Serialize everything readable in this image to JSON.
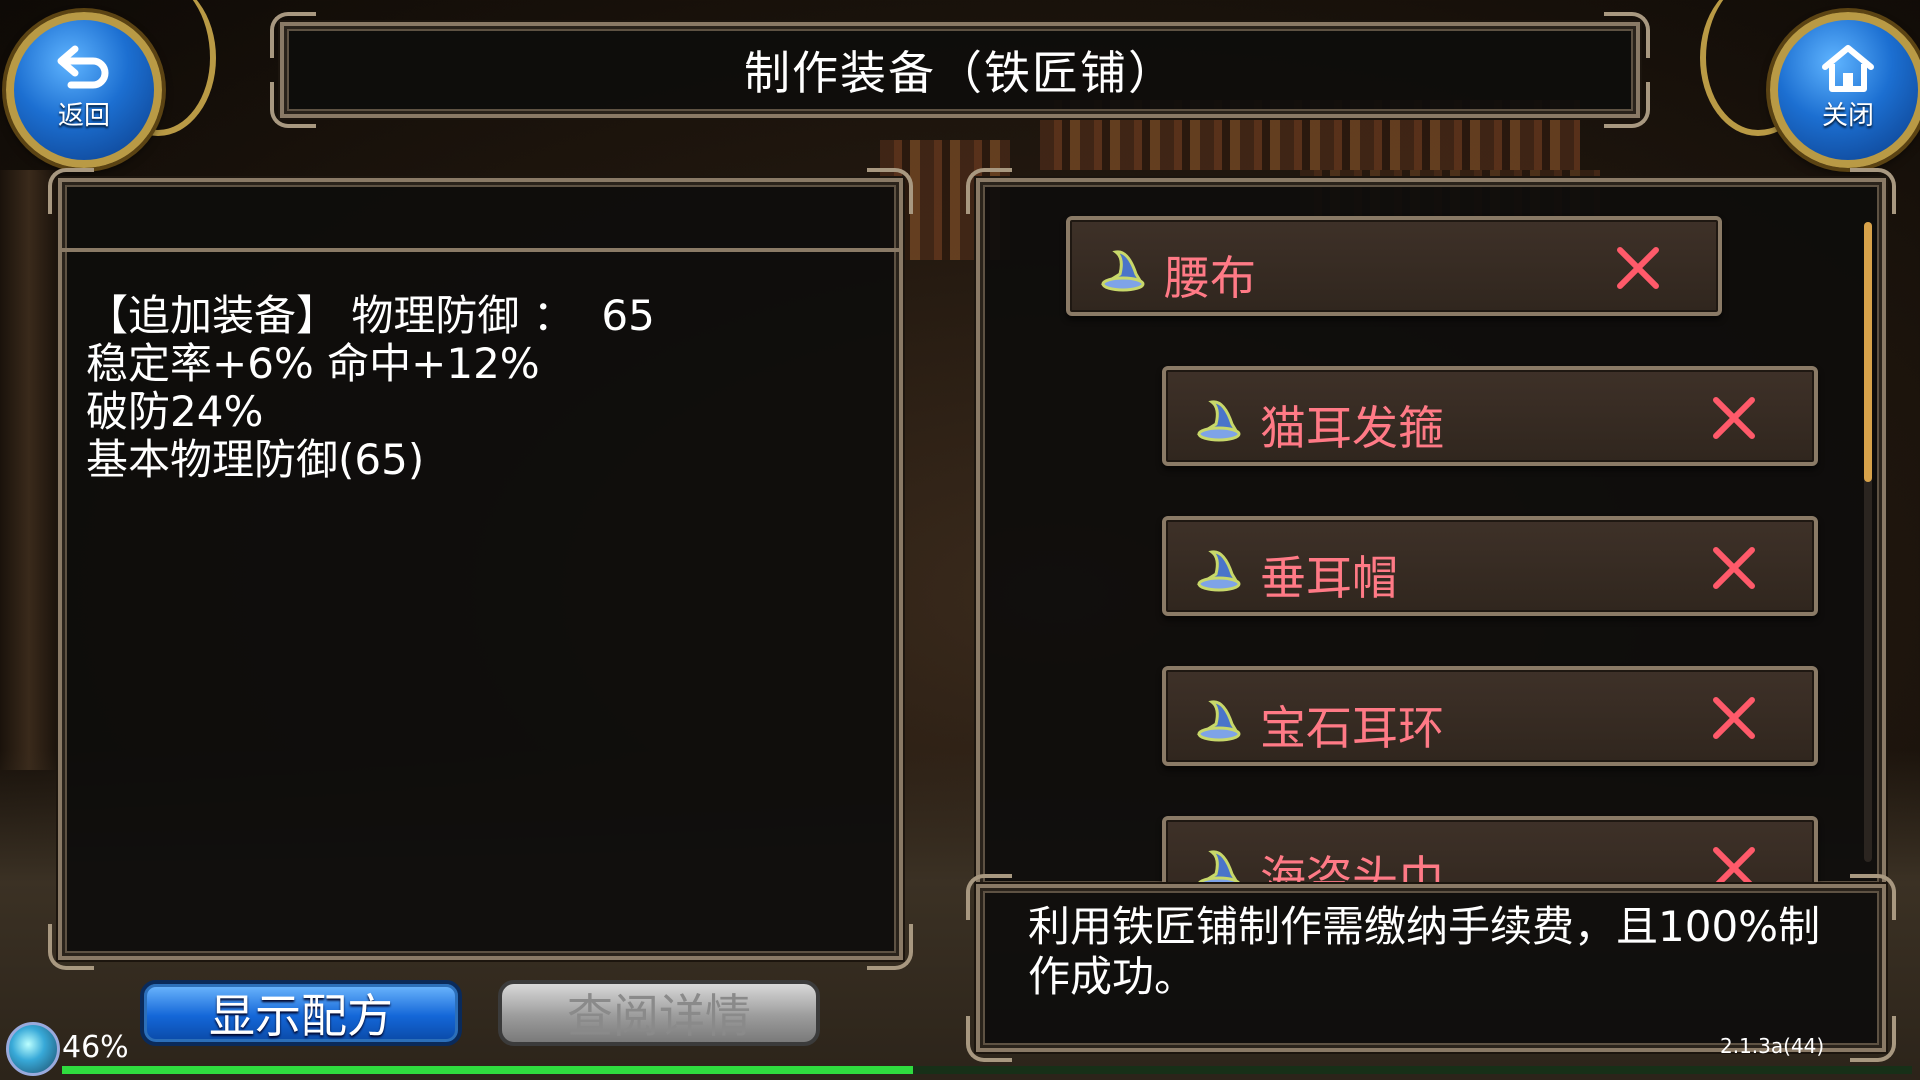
{
  "title": "制作装备（铁匠铺）",
  "nav": {
    "back_label": "返回",
    "close_label": "关闭"
  },
  "stats_lines": [
    "【追加装备】 物理防御 ：  65",
    "稳定率+6% 命中+12%",
    "破防24%",
    "基本物理防御(65)"
  ],
  "equipment_list": [
    {
      "name": "腰布"
    },
    {
      "name": "猫耳发箍"
    },
    {
      "name": "垂耳帽"
    },
    {
      "name": "宝石耳环"
    },
    {
      "name": "海盗头巾"
    }
  ],
  "notice": "利用铁匠铺制作需缴纳手续费，且100%制作成功。",
  "buttons": {
    "show_recipe": "显示配方",
    "view_details": "查阅详情"
  },
  "status": {
    "loading_percent": "46%",
    "progress": 0.46,
    "version": "2.1.3a(44)"
  },
  "colors": {
    "item_name": "#ff7a86",
    "accent_blue": "#1467d8",
    "progress_green": "#2fdc3f",
    "frame_border": "#8a7a66"
  }
}
